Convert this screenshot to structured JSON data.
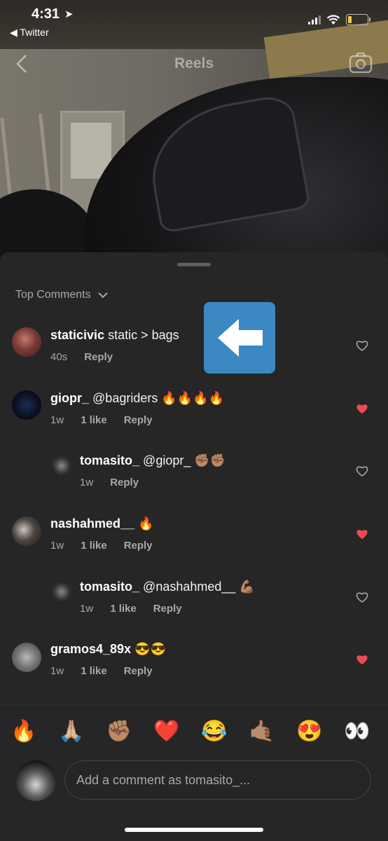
{
  "status_bar": {
    "time": "4:31",
    "back_app": "◀ Twitter"
  },
  "nav": {
    "title": "Reels"
  },
  "sheet": {
    "sort_label": "Top Comments",
    "comments": [
      {
        "user": "staticivic",
        "text": "static > bags",
        "time": "40s",
        "likes": "",
        "reply": "Reply",
        "liked": false
      },
      {
        "user": "giopr_",
        "text": "@bagriders 🔥🔥🔥🔥",
        "time": "1w",
        "likes": "1 like",
        "reply": "Reply",
        "liked": true
      },
      {
        "user": "tomasito_",
        "text": "@giopr_ ✊🏽✊🏽",
        "time": "1w",
        "likes": "",
        "reply": "Reply",
        "liked": false
      },
      {
        "user": "nashahmed__",
        "text": "🔥",
        "time": "1w",
        "likes": "1 like",
        "reply": "Reply",
        "liked": true
      },
      {
        "user": "tomasito_",
        "text": "@nashahmed__ 💪🏽",
        "time": "1w",
        "likes": "1 like",
        "reply": "Reply",
        "liked": false
      },
      {
        "user": "gramos4_89x",
        "text": "😎😎",
        "time": "1w",
        "likes": "1 like",
        "reply": "Reply",
        "liked": true
      }
    ]
  },
  "emoji_bar": [
    "🔥",
    "🙏🏼",
    "✊🏽",
    "❤️",
    "😂",
    "🤙🏽",
    "😍",
    "👀"
  ],
  "input": {
    "placeholder": "Add a comment as tomasito_..."
  },
  "colors": {
    "sheet_bg": "#262626",
    "liked_heart": "#ed4956",
    "overlay_arrow": "#3b88c3"
  }
}
